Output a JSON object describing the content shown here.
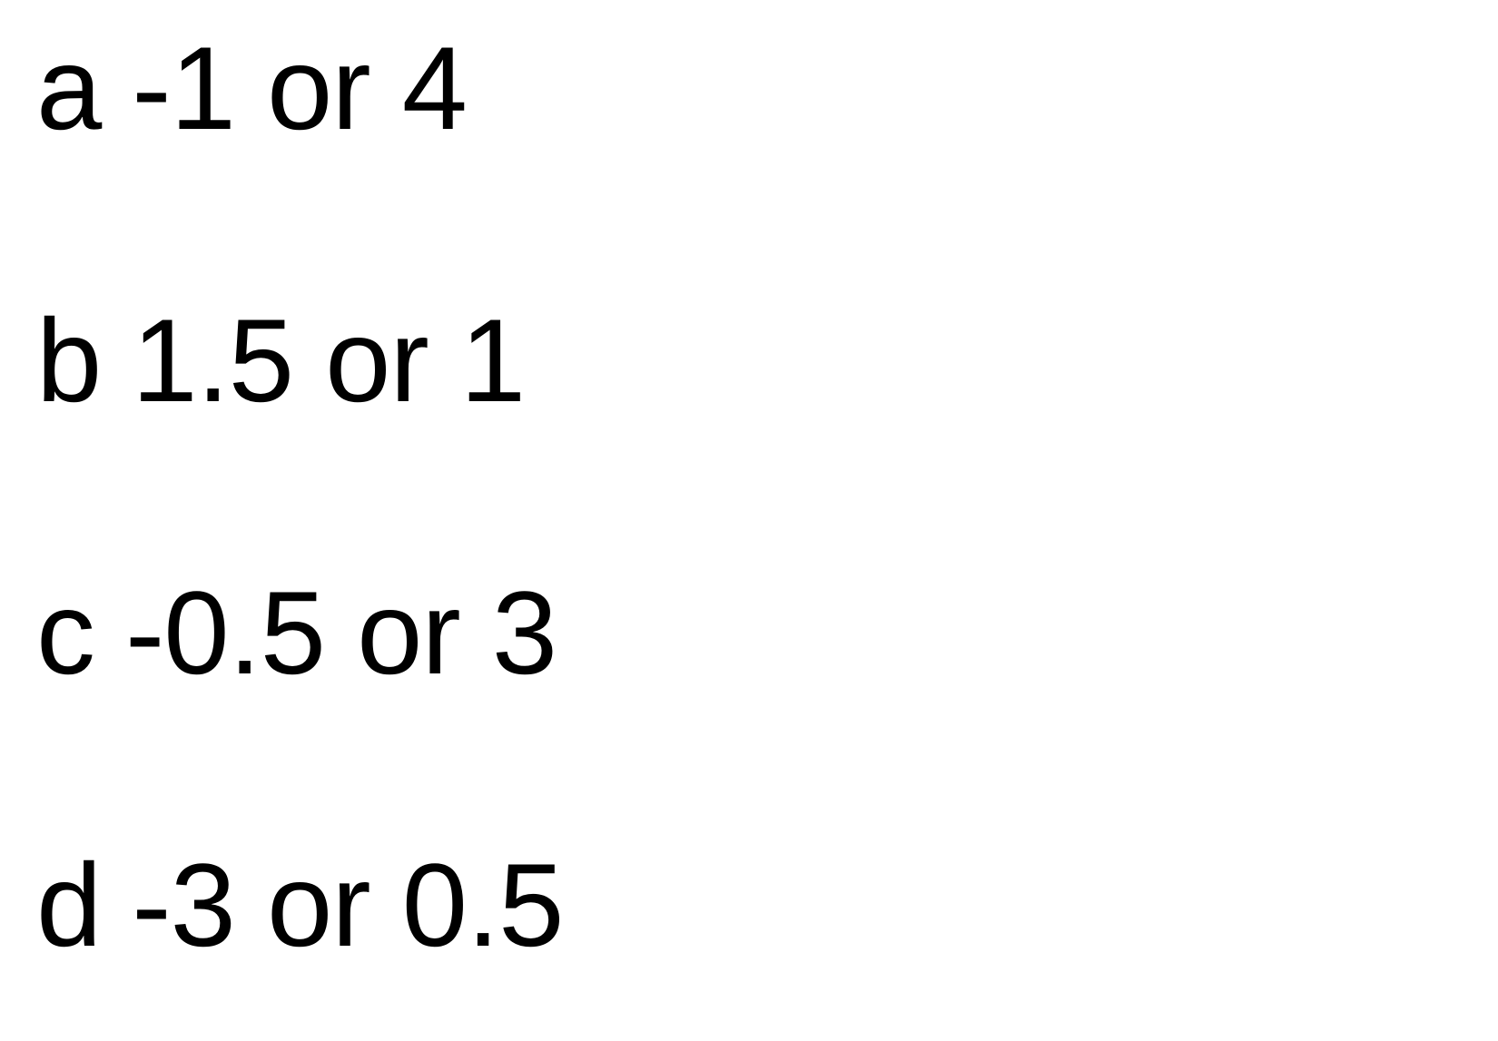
{
  "options": [
    {
      "letter": "a",
      "answer": "-1 or 4"
    },
    {
      "letter": "b",
      "answer": "1.5 or 1"
    },
    {
      "letter": "c",
      "answer": "-0.5 or 3"
    },
    {
      "letter": "d",
      "answer": "-3 or 0.5"
    }
  ],
  "colors": {
    "background": "#ffffff",
    "text": "#000000"
  }
}
